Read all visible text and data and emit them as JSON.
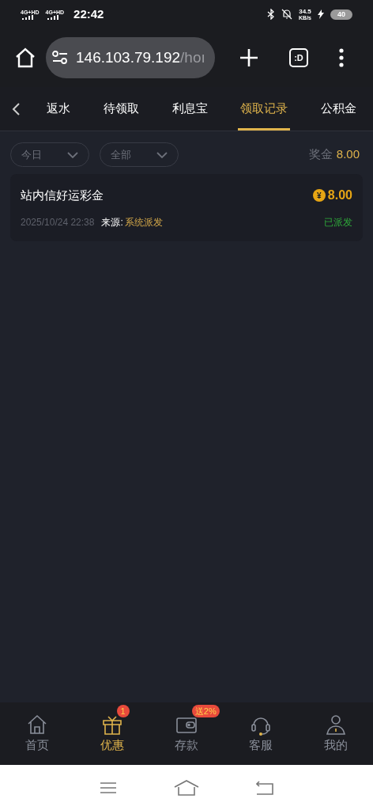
{
  "status_bar": {
    "signals": [
      "4G+HD",
      "4G+HD"
    ],
    "time": "22:42",
    "speed": "34.5",
    "speed_unit": "KB/s",
    "battery": "40"
  },
  "browser": {
    "url_host": "146.103.79.192",
    "url_path": "/hoı",
    "tab_label": ":D"
  },
  "tabs": [
    {
      "label": "返水",
      "selected": false
    },
    {
      "label": "待领取",
      "selected": false
    },
    {
      "label": "利息宝",
      "selected": false
    },
    {
      "label": "领取记录",
      "selected": true
    },
    {
      "label": "公积金",
      "selected": false
    }
  ],
  "filters": [
    {
      "label": "今日"
    },
    {
      "label": "全部"
    }
  ],
  "total": {
    "label": "奖金",
    "value": "8.00"
  },
  "records": [
    {
      "title": "站内信好运彩金",
      "coin": "¥",
      "amount": "8.00",
      "time": "2025/10/24 22:38",
      "source_label": "来源:",
      "source": "系统派发",
      "status": "已派发"
    }
  ],
  "bottom_nav": [
    {
      "kind": "home",
      "label": "首页",
      "selected": false
    },
    {
      "kind": "gift",
      "label": "优惠",
      "selected": true,
      "badge": "1"
    },
    {
      "kind": "wallet",
      "label": "存款",
      "selected": false,
      "badge": "送2%"
    },
    {
      "kind": "support",
      "label": "客服",
      "selected": false
    },
    {
      "kind": "user",
      "label": "我的",
      "selected": false
    }
  ]
}
